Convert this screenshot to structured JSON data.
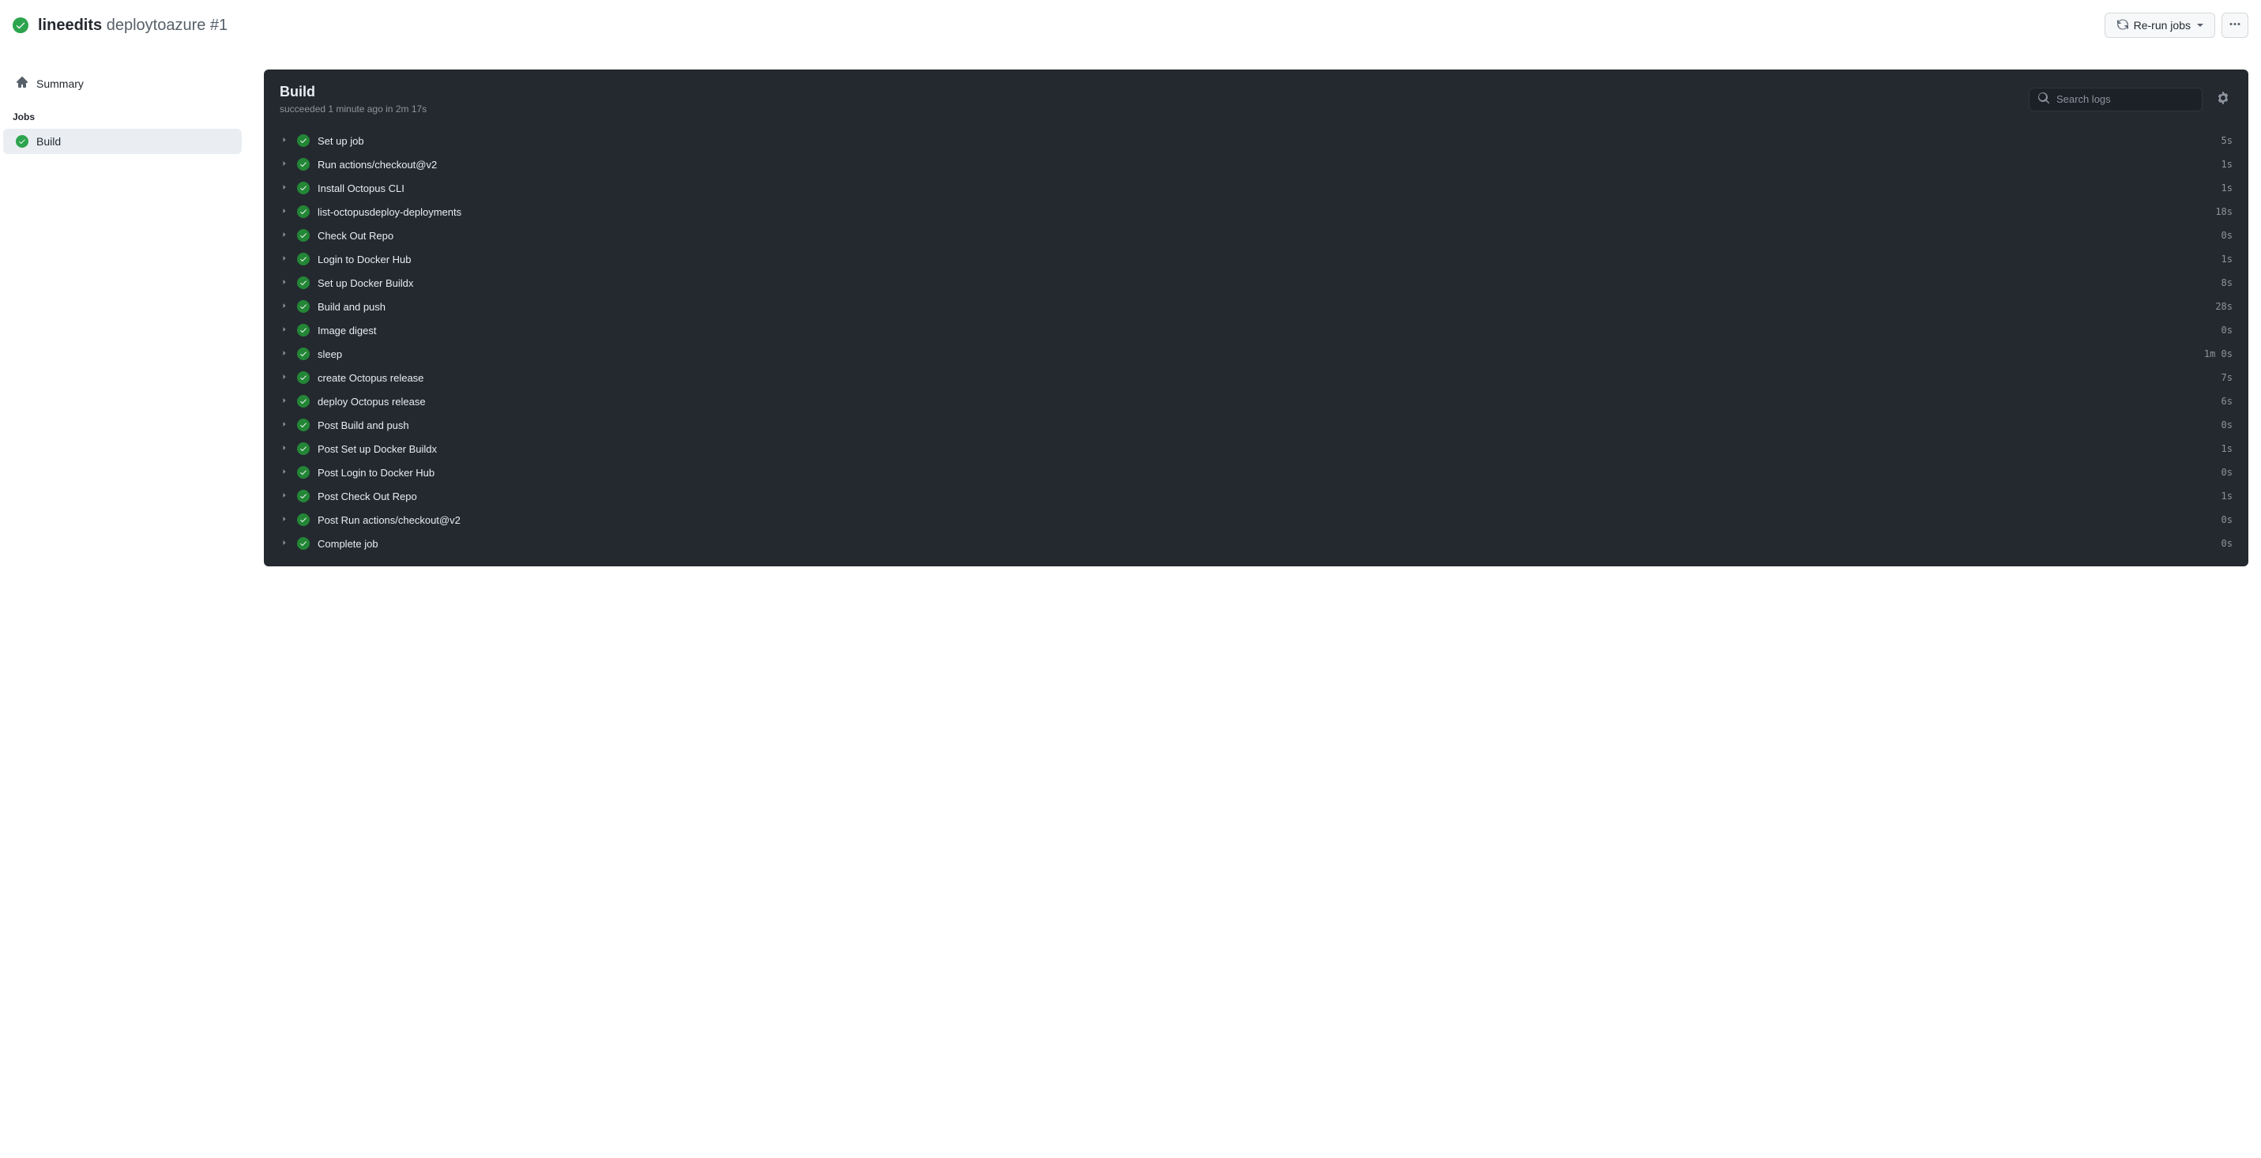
{
  "header": {
    "repo": "lineedits",
    "workflow": "deploytoazure",
    "run_number": "#1",
    "rerun_label": "Re-run jobs"
  },
  "sidebar": {
    "summary_label": "Summary",
    "section_title": "Jobs",
    "job_label": "Build"
  },
  "panel": {
    "title": "Build",
    "sub_status": "succeeded",
    "sub_when": "1 minute ago",
    "sub_in": "in",
    "sub_duration": "2m 17s",
    "search_placeholder": "Search logs",
    "steps": [
      {
        "name": "Set up job",
        "duration": "5s"
      },
      {
        "name": "Run actions/checkout@v2",
        "duration": "1s"
      },
      {
        "name": "Install Octopus CLI",
        "duration": "1s"
      },
      {
        "name": "list-octopusdeploy-deployments",
        "duration": "18s"
      },
      {
        "name": "Check Out Repo",
        "duration": "0s"
      },
      {
        "name": "Login to Docker Hub",
        "duration": "1s"
      },
      {
        "name": "Set up Docker Buildx",
        "duration": "8s"
      },
      {
        "name": "Build and push",
        "duration": "28s"
      },
      {
        "name": "Image digest",
        "duration": "0s"
      },
      {
        "name": "sleep",
        "duration": "1m 0s"
      },
      {
        "name": "create Octopus release",
        "duration": "7s"
      },
      {
        "name": "deploy Octopus release",
        "duration": "6s"
      },
      {
        "name": "Post Build and push",
        "duration": "0s"
      },
      {
        "name": "Post Set up Docker Buildx",
        "duration": "1s"
      },
      {
        "name": "Post Login to Docker Hub",
        "duration": "0s"
      },
      {
        "name": "Post Check Out Repo",
        "duration": "1s"
      },
      {
        "name": "Post Run actions/checkout@v2",
        "duration": "0s"
      },
      {
        "name": "Complete job",
        "duration": "0s"
      }
    ]
  }
}
